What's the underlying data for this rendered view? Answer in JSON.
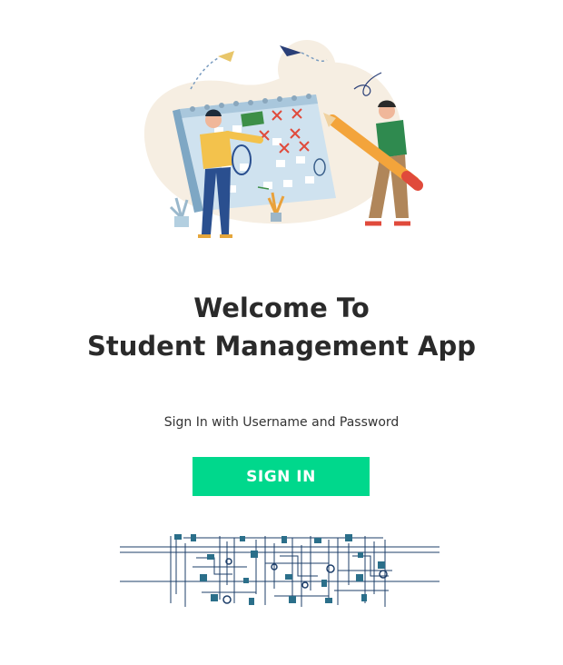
{
  "welcome": {
    "line1": "Welcome To",
    "line2": "Student Management App"
  },
  "subtitle": "Sign In with Username and Password",
  "signin_button": {
    "label": "SIGN IN",
    "color": "#00d88c"
  },
  "hero_illustration": {
    "icon": "calendar-planning-illustration"
  },
  "footer_illustration": {
    "icon": "circuit-network-illustration"
  }
}
